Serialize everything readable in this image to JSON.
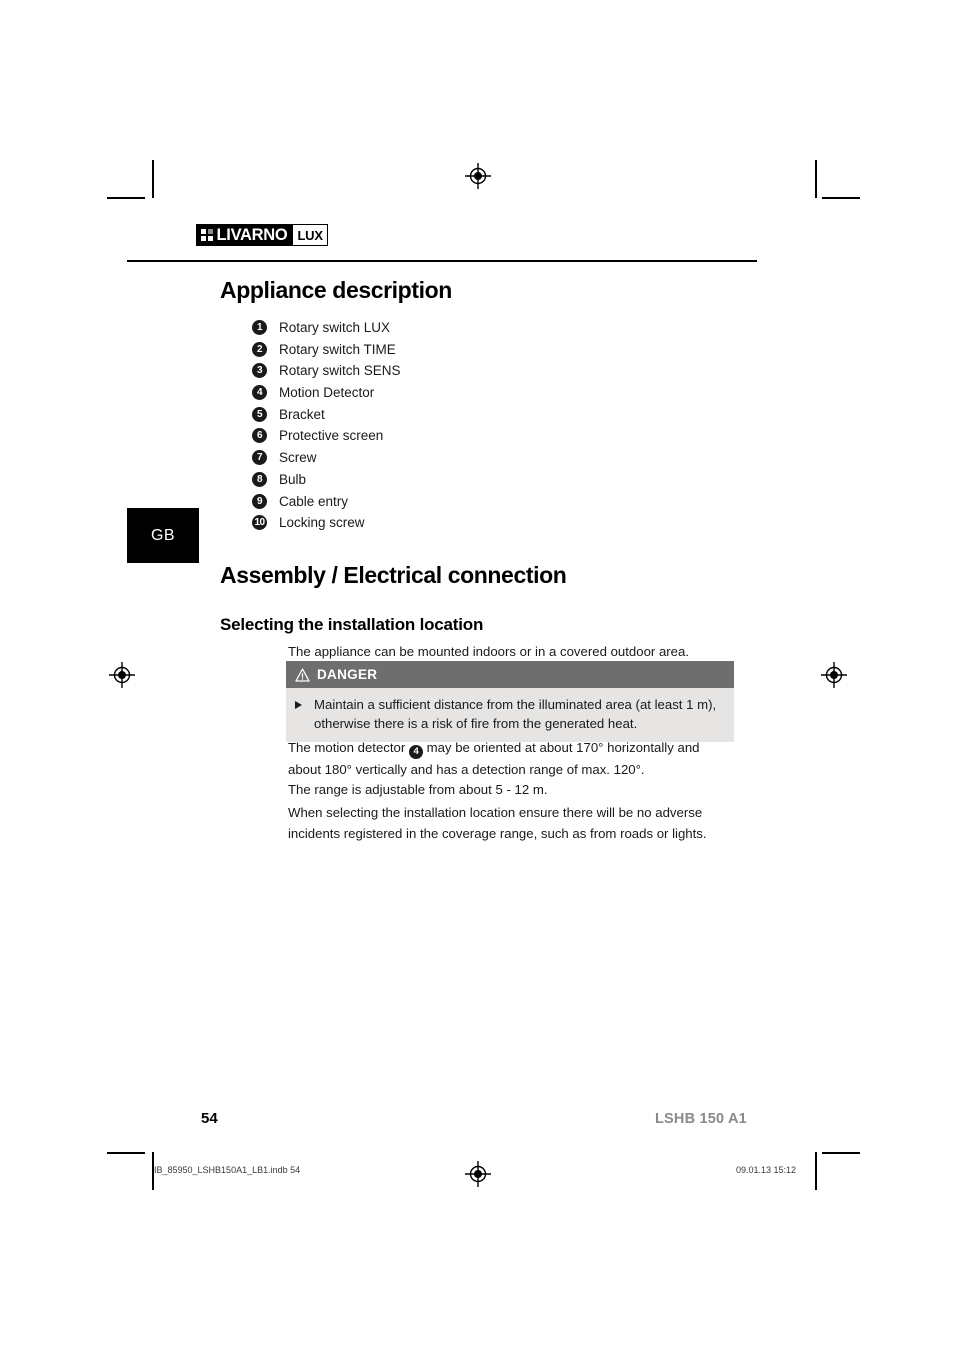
{
  "brand": {
    "logo_word": "LIVARNO",
    "logo_suffix": "LUX"
  },
  "language_badge": "GB",
  "sections": {
    "appliance_description": {
      "heading": "Appliance description",
      "parts": [
        {
          "num": "1",
          "label": "Rotary switch LUX"
        },
        {
          "num": "2",
          "label": "Rotary switch TIME"
        },
        {
          "num": "3",
          "label": "Rotary switch SENS"
        },
        {
          "num": "4",
          "label": "Motion Detector"
        },
        {
          "num": "5",
          "label": "Bracket"
        },
        {
          "num": "6",
          "label": "Protective screen"
        },
        {
          "num": "7",
          "label": "Screw"
        },
        {
          "num": "8",
          "label": "Bulb"
        },
        {
          "num": "9",
          "label": "Cable entry"
        },
        {
          "num": "10",
          "label": "Locking screw"
        }
      ]
    },
    "assembly": {
      "heading": "Assembly / Electrical connection",
      "subheading": "Selecting the installation location",
      "intro": "The appliance can be mounted indoors or in a covered outdoor area.",
      "danger": {
        "label": "DANGER",
        "icon": "warning-triangle-icon",
        "text": "Maintain a sufficient distance from the illuminated area (at least 1 m), otherwise there is a risk of fire from the generated heat."
      },
      "paragraph_detector_before": "The motion detector ",
      "paragraph_detector_marker": "4",
      "paragraph_detector_after": " may be oriented at about 170° horizontally and about 180° vertically and has a detection range of max. 120°.",
      "paragraph_range": "The range is adjustable from about 5 - 12 m.",
      "paragraph_coverage": "When selecting the installation location ensure there will be no adverse incidents registered in the coverage range, such as from roads or lights."
    }
  },
  "footer": {
    "page_number": "54",
    "model": "LSHB 150 A1",
    "imprint_file": "IB_85950_LSHB150A1_LB1.indb   54",
    "imprint_timestamp": "09.01.13   15:12"
  },
  "colors": {
    "danger_header": "#6e6e6e",
    "danger_body": "#e7e5e3",
    "model_gray": "#8a8a8a"
  }
}
